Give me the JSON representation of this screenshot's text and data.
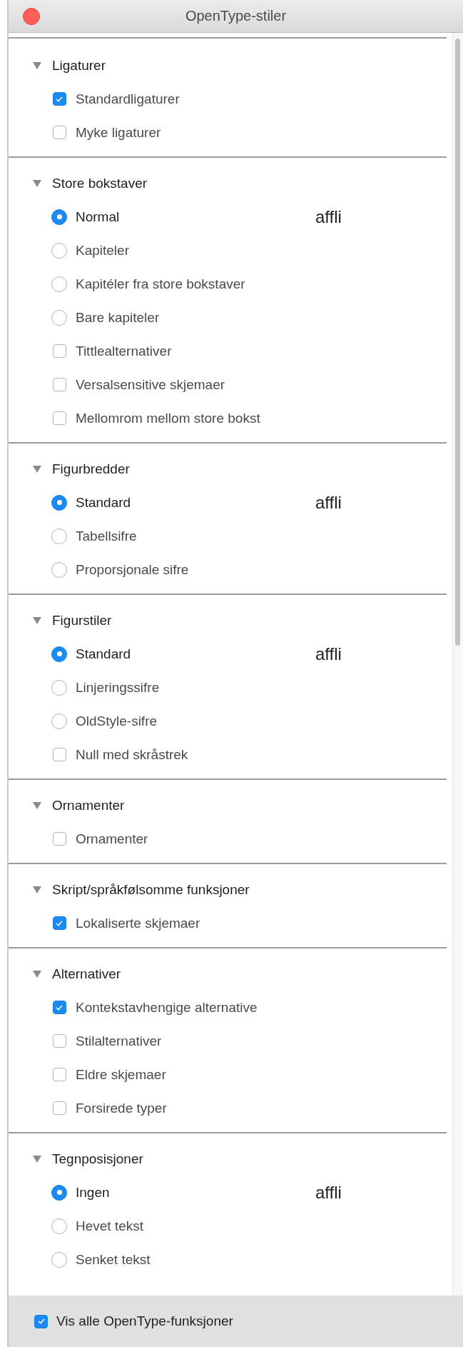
{
  "window": {
    "title": "OpenType-stiler"
  },
  "sections": [
    {
      "title": "Ligaturer",
      "expanded": true,
      "options": [
        {
          "kind": "checkbox",
          "label": "Standardligaturer",
          "checked": true
        },
        {
          "kind": "checkbox",
          "label": "Myke ligaturer",
          "checked": false
        }
      ]
    },
    {
      "title": "Store bokstaver",
      "expanded": true,
      "options": [
        {
          "kind": "radio",
          "label": "Normal",
          "selected": true,
          "preview": "affli"
        },
        {
          "kind": "radio",
          "label": "Kapiteler",
          "selected": false
        },
        {
          "kind": "radio",
          "label": "Kapitéler fra store bokstaver",
          "selected": false
        },
        {
          "kind": "radio",
          "label": "Bare kapiteler",
          "selected": false
        },
        {
          "kind": "checkbox",
          "label": "Tittlealternativer",
          "checked": false
        },
        {
          "kind": "checkbox",
          "label": "Versalsensitive skjemaer",
          "checked": false
        },
        {
          "kind": "checkbox",
          "label": "Mellomrom mellom store bokst",
          "checked": false
        }
      ]
    },
    {
      "title": "Figurbredder",
      "expanded": true,
      "options": [
        {
          "kind": "radio",
          "label": "Standard",
          "selected": true,
          "preview": "affli"
        },
        {
          "kind": "radio",
          "label": "Tabellsifre",
          "selected": false
        },
        {
          "kind": "radio",
          "label": "Proporsjonale sifre",
          "selected": false
        }
      ]
    },
    {
      "title": "Figurstiler",
      "expanded": true,
      "options": [
        {
          "kind": "radio",
          "label": "Standard",
          "selected": true,
          "preview": "affli"
        },
        {
          "kind": "radio",
          "label": "Linjeringssifre",
          "selected": false
        },
        {
          "kind": "radio",
          "label": "OldStyle-sifre",
          "selected": false
        },
        {
          "kind": "checkbox",
          "label": "Null med skråstrek",
          "checked": false
        }
      ]
    },
    {
      "title": "Ornamenter",
      "expanded": true,
      "options": [
        {
          "kind": "checkbox",
          "label": "Ornamenter",
          "checked": false
        }
      ]
    },
    {
      "title": "Skript/språkfølsomme funksjoner",
      "expanded": true,
      "options": [
        {
          "kind": "checkbox",
          "label": "Lokaliserte skjemaer",
          "checked": true
        }
      ]
    },
    {
      "title": "Alternativer",
      "expanded": true,
      "options": [
        {
          "kind": "checkbox",
          "label": "Kontekstavhengige alternative",
          "checked": true
        },
        {
          "kind": "checkbox",
          "label": "Stilalternativer",
          "checked": false
        },
        {
          "kind": "checkbox",
          "label": "Eldre skjemaer",
          "checked": false
        },
        {
          "kind": "checkbox",
          "label": "Forsirede typer",
          "checked": false
        }
      ]
    },
    {
      "title": "Tegnposisjoner",
      "expanded": true,
      "options": [
        {
          "kind": "radio",
          "label": "Ingen",
          "selected": true,
          "preview": "affli"
        },
        {
          "kind": "radio",
          "label": "Hevet tekst",
          "selected": false
        },
        {
          "kind": "radio",
          "label": "Senket tekst",
          "selected": false
        }
      ]
    }
  ],
  "footer": {
    "label": "Vis alle OpenType-funksjoner",
    "checked": true
  }
}
